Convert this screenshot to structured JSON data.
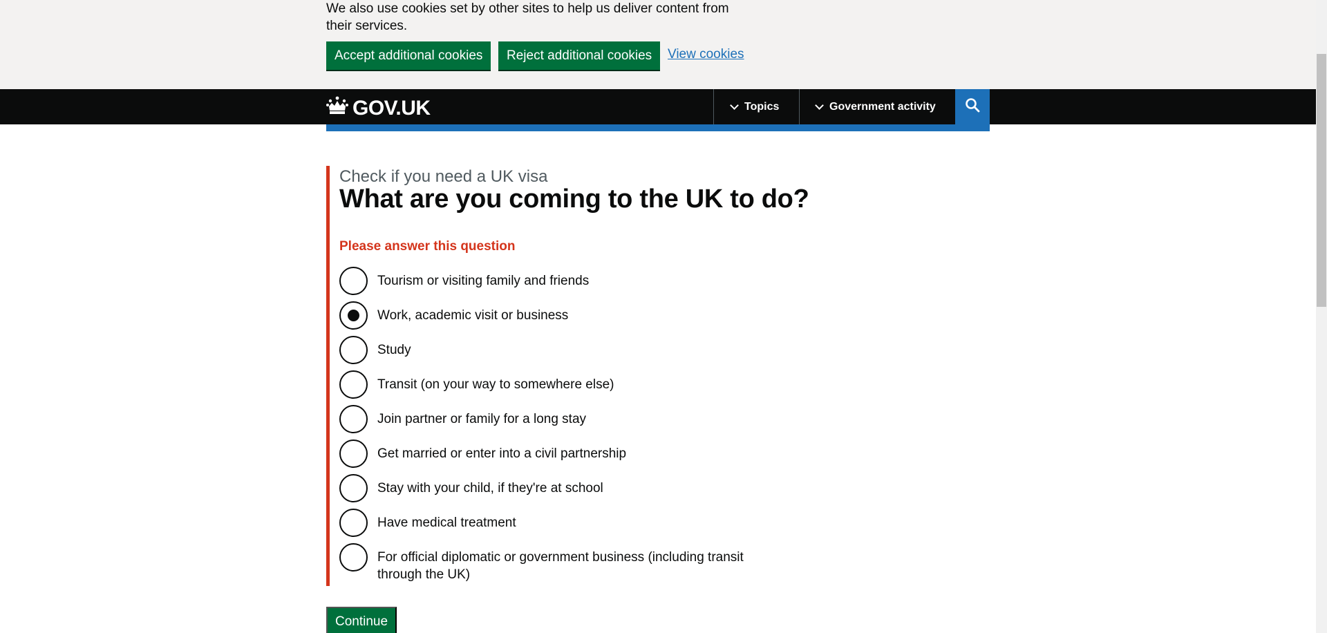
{
  "cookie_banner": {
    "text": "We also use cookies set by other sites to help us deliver content from their services.",
    "accept_label": "Accept additional cookies",
    "reject_label": "Reject additional cookies",
    "view_label": "View cookies"
  },
  "header": {
    "logo_text": "GOV.UK",
    "nav": {
      "topics_label": "Topics",
      "government_activity_label": "Government activity"
    },
    "icons": {
      "logo": "crown-icon",
      "search": "search-icon",
      "chevron": "chevron-down-icon"
    }
  },
  "form": {
    "caption": "Check if you need a UK visa",
    "question": "What are you coming to the UK to do?",
    "error": "Please answer this question",
    "options": [
      {
        "label": "Tourism or visiting family and friends",
        "checked": false
      },
      {
        "label": "Work, academic visit or business",
        "checked": true
      },
      {
        "label": "Study",
        "checked": false
      },
      {
        "label": "Transit (on your way to somewhere else)",
        "checked": false
      },
      {
        "label": "Join partner or family for a long stay",
        "checked": false
      },
      {
        "label": "Get married or enter into a civil partnership",
        "checked": false
      },
      {
        "label": "Stay with your child, if they're at school",
        "checked": false
      },
      {
        "label": "Have medical treatment",
        "checked": false
      },
      {
        "label": "For official diplomatic or government business (including transit through the UK)",
        "checked": false
      }
    ],
    "continue_label": "Continue"
  },
  "colors": {
    "button_green": "#00703c",
    "error_red": "#d4351c",
    "link_blue": "#1d70b8",
    "header_black": "#0b0c0c",
    "banner_grey": "#f3f2f1"
  }
}
